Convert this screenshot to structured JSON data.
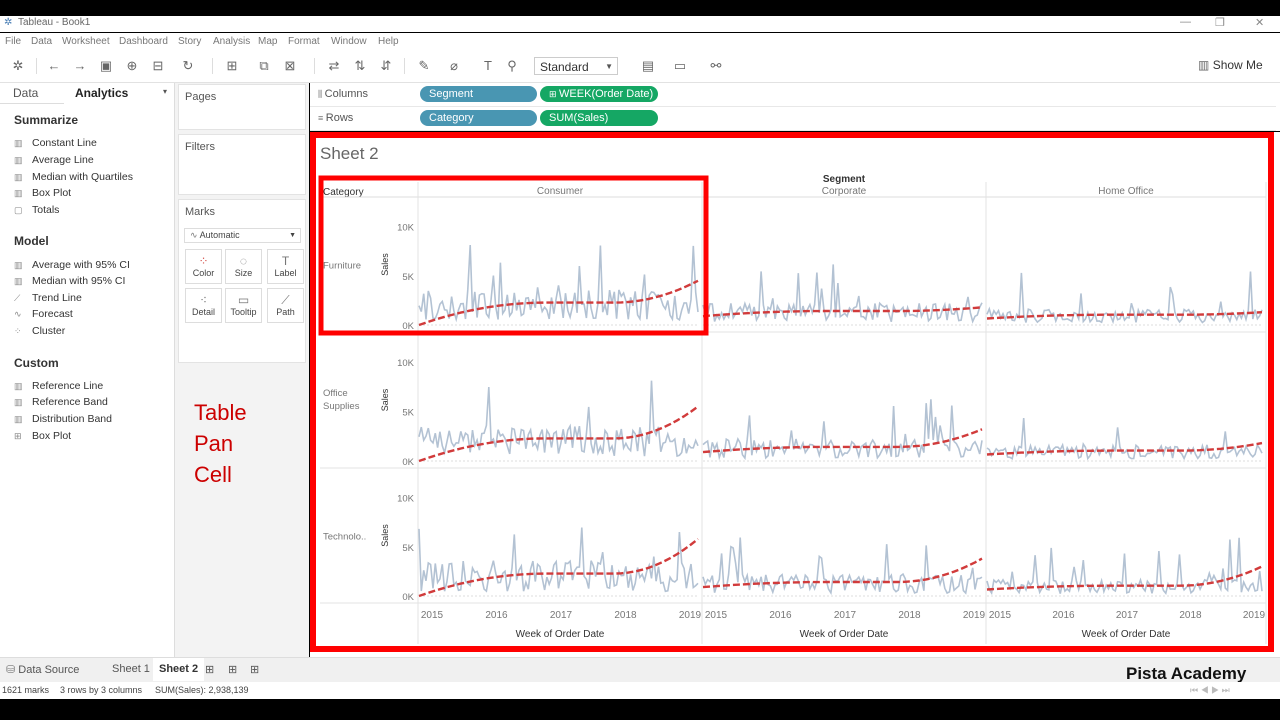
{
  "window": {
    "title": "Tableau - Book1"
  },
  "menu": [
    "File",
    "Data",
    "Worksheet",
    "Dashboard",
    "Story",
    "Analysis",
    "Map",
    "Format",
    "Window",
    "Help"
  ],
  "toolbar": {
    "view_mode": "Standard",
    "show_me": "Show Me"
  },
  "left_pane": {
    "tabs": [
      "Data",
      "Analytics"
    ],
    "summarize": {
      "title": "Summarize",
      "items": [
        "Constant Line",
        "Average Line",
        "Median with Quartiles",
        "Box Plot",
        "Totals"
      ]
    },
    "model": {
      "title": "Model",
      "items": [
        "Average with 95% CI",
        "Median with 95% CI",
        "Trend Line",
        "Forecast",
        "Cluster"
      ]
    },
    "custom": {
      "title": "Custom",
      "items": [
        "Reference Line",
        "Reference Band",
        "Distribution Band",
        "Box Plot"
      ]
    }
  },
  "cards": {
    "pages": "Pages",
    "filters": "Filters",
    "marks": {
      "title": "Marks",
      "type": "Automatic",
      "buttons": [
        "Color",
        "Size",
        "Label",
        "Detail",
        "Tooltip",
        "Path"
      ]
    }
  },
  "shelves": {
    "columns_label": "Columns",
    "rows_label": "Rows",
    "columns": [
      "Segment",
      "WEEK(Order Date)"
    ],
    "rows": [
      "Category",
      "SUM(Sales)"
    ]
  },
  "sheet": {
    "title": "Sheet 2",
    "segment_header": "Segment",
    "category_header": "Category",
    "columns": [
      "Consumer",
      "Corporate",
      "Home Office"
    ],
    "rows": [
      "Furniture",
      "Office Supplies",
      "Technolo.."
    ],
    "y_axis_title": "Sales",
    "y_ticks": [
      "10K",
      "5K",
      "0K"
    ],
    "x_ticks": [
      "2015",
      "2016",
      "2017",
      "2018",
      "2019"
    ],
    "x_axis_title": "Week of Order Date"
  },
  "annotation": [
    "Table",
    "Pan",
    "Cell"
  ],
  "bottom_tabs": [
    "Data Source",
    "Sheet 1",
    "Sheet 2"
  ],
  "status": {
    "marks": "1621 marks",
    "dims": "3 rows by 3 columns",
    "sum": "SUM(Sales): 2,938,139"
  },
  "watermark": "Pista Academy",
  "colors": {
    "line": "#b3c2d3",
    "trend": "#d13b3b",
    "highlight": "#ff0000",
    "pill_blue": "#4996b2",
    "pill_green": "#15a764"
  },
  "chart_data": {
    "type": "line",
    "ylim": [
      0,
      12000
    ],
    "x": [
      "2015",
      "2016",
      "2017",
      "2018",
      "2019"
    ],
    "trend_end_values": {
      "Furniture": {
        "Consumer": 4500,
        "Corporate": 1800,
        "Home Office": 1300
      },
      "Office Supplies": {
        "Consumer": 5500,
        "Corporate": 3200,
        "Home Office": 1800
      },
      "Technolo..": {
        "Consumer": 5800,
        "Corporate": 3800,
        "Home Office": 3000
      }
    }
  }
}
